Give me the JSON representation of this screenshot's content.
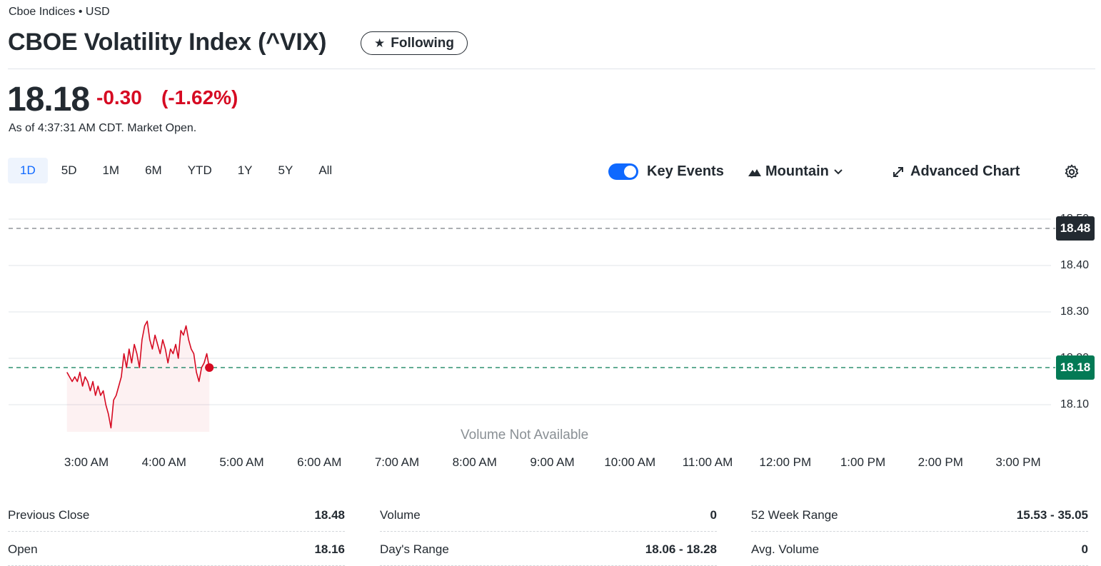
{
  "header": {
    "exchange": "Cboe Indices • USD",
    "title": "CBOE Volatility Index (^VIX)",
    "follow_label": "Following"
  },
  "quote": {
    "price": "18.18",
    "change": "-0.30",
    "change_pct": "(-1.62%)",
    "as_of": "As of 4:37:31 AM CDT. Market Open.",
    "down_color": "#d60a22"
  },
  "range_tabs": [
    "1D",
    "5D",
    "1M",
    "6M",
    "YTD",
    "1Y",
    "5Y",
    "All"
  ],
  "active_range": "1D",
  "controls": {
    "key_events_label": "Key Events",
    "key_events_on": true,
    "chart_type_label": "Mountain",
    "advanced_label": "Advanced Chart",
    "accent_color": "#0f69ff"
  },
  "chart_data": {
    "type": "area",
    "title": "",
    "xlabel": "",
    "ylabel": "",
    "ylim": [
      18.03,
      18.53
    ],
    "y_ticks": [
      "18.50",
      "18.40",
      "18.30",
      "18.20",
      "18.10"
    ],
    "x_ticks": [
      "3:00 AM",
      "4:00 AM",
      "5:00 AM",
      "6:00 AM",
      "7:00 AM",
      "8:00 AM",
      "9:00 AM",
      "10:00 AM",
      "11:00 AM",
      "12:00 PM",
      "1:00 PM",
      "2:00 PM",
      "3:00 PM"
    ],
    "previous_close": 18.48,
    "previous_close_label": "18.48",
    "last_price": 18.18,
    "last_price_label": "18.18",
    "volume_note": "Volume Not Available",
    "series_color": "#d60a22",
    "current_price_flag_color": "#047a55",
    "prev_close_flag_color": "#232a31",
    "session_start": "2:45 AM",
    "minutes_per_point": 2,
    "values": [
      18.17,
      18.16,
      18.15,
      18.16,
      18.15,
      18.17,
      18.14,
      18.16,
      18.15,
      18.13,
      18.15,
      18.12,
      18.14,
      18.12,
      18.13,
      18.1,
      18.08,
      18.05,
      18.11,
      18.12,
      18.14,
      18.16,
      18.21,
      18.18,
      18.22,
      18.19,
      18.23,
      18.21,
      18.18,
      18.24,
      18.27,
      18.28,
      18.24,
      18.22,
      18.25,
      18.23,
      18.21,
      18.24,
      18.22,
      18.19,
      18.22,
      18.21,
      18.23,
      18.2,
      18.26,
      18.25,
      18.27,
      18.24,
      18.22,
      18.21,
      18.17,
      18.15,
      18.18,
      18.19,
      18.21,
      18.18
    ]
  },
  "stats": {
    "col1": [
      {
        "label": "Previous Close",
        "value": "18.48"
      },
      {
        "label": "Open",
        "value": "18.16"
      }
    ],
    "col2": [
      {
        "label": "Volume",
        "value": "0"
      },
      {
        "label": "Day's Range",
        "value": "18.06 - 18.28"
      }
    ],
    "col3": [
      {
        "label": "52 Week Range",
        "value": "15.53 - 35.05"
      },
      {
        "label": "Avg. Volume",
        "value": "0"
      }
    ]
  }
}
